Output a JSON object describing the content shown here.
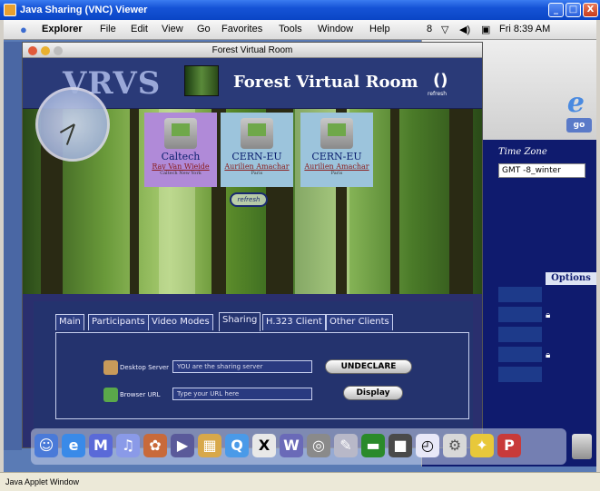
{
  "xp_window": {
    "title": "Java Sharing (VNC) Viewer",
    "min": "_",
    "max": "□",
    "close": "X"
  },
  "mac_menu": {
    "items": [
      "Explorer",
      "File",
      "Edit",
      "View",
      "Go",
      "Favorites",
      "Tools",
      "Window",
      "Help"
    ],
    "status_num": "8",
    "clock": "Fri 8:39 AM"
  },
  "forest_window": {
    "title": "Forest Virtual Room",
    "logo": "VRVS",
    "heading": "Forest Virtual Room",
    "refresh_symbol": "()",
    "refresh_label": "refresh",
    "refresh_pill": "refresh",
    "participants": [
      {
        "site": "Caltech",
        "user": "Ray Van Wieide",
        "sub": "Caltech New York"
      },
      {
        "site": "CERN-EU",
        "user": "Aurilien Amachar",
        "sub": "Paris"
      },
      {
        "site": "CERN-EU",
        "user": "Aurilien Amachar",
        "sub": "Paris"
      }
    ],
    "tabs": [
      "Main",
      "Participants",
      "Video Modes",
      "Sharing",
      "H.323 Client",
      "Other Clients"
    ],
    "active_tab": "Sharing",
    "desktop_server_label": "Desktop Server",
    "desktop_server_value": "YOU are the sharing server",
    "undeclare_button": "UNDECLARE",
    "browser_url_label": "Browser URL",
    "browser_url_placeholder": "Type your URL here",
    "display_button": "Display"
  },
  "background_window": {
    "go": "go",
    "time_zone_label": "Time Zone",
    "time_zone_value": "GMT -8_winter",
    "options_header": "Options"
  },
  "status_bar": {
    "text": "Java Applet Window"
  }
}
